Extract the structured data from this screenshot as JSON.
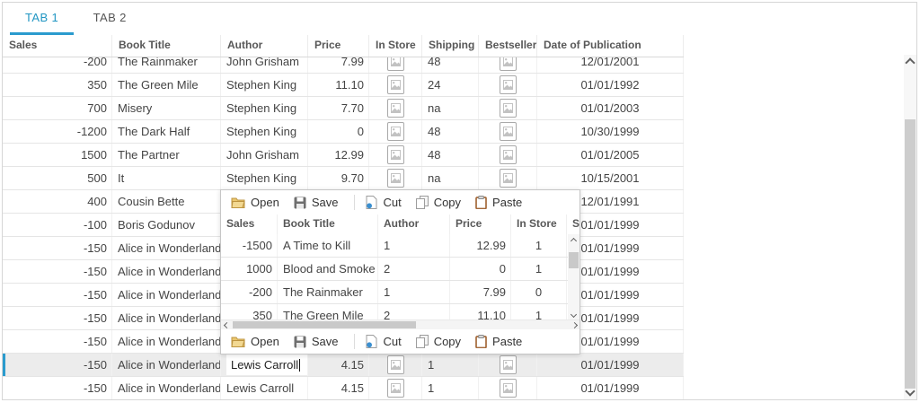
{
  "tabs": {
    "tab1": "TAB 1",
    "tab2": "TAB 2"
  },
  "colors": {
    "accent": "#2196c3",
    "selection_bar": "#2a9bce"
  },
  "toolbar": {
    "open": "Open",
    "save": "Save",
    "cut": "Cut",
    "copy": "Copy",
    "paste": "Paste"
  },
  "grid": {
    "columns": [
      "Sales",
      "Book Title",
      "Author",
      "Price",
      "In Store",
      "Shipping",
      "Bestseller",
      "Date of Publication"
    ],
    "rows": [
      {
        "sales": "-200",
        "title": "The Rainmaker",
        "author": "John Grisham",
        "price": "7.99",
        "shipping": "48",
        "date": "12/01/2001",
        "icons": true
      },
      {
        "sales": "350",
        "title": "The Green Mile",
        "author": "Stephen King",
        "price": "11.10",
        "shipping": "24",
        "date": "01/01/1992",
        "icons": true
      },
      {
        "sales": "700",
        "title": "Misery",
        "author": "Stephen King",
        "price": "7.70",
        "shipping": "na",
        "date": "01/01/2003",
        "icons": true
      },
      {
        "sales": "-1200",
        "title": "The Dark Half",
        "author": "Stephen King",
        "price": "0",
        "shipping": "48",
        "date": "10/30/1999",
        "icons": true
      },
      {
        "sales": "1500",
        "title": "The Partner",
        "author": "John Grisham",
        "price": "12.99",
        "shipping": "48",
        "date": "01/01/2005",
        "icons": true
      },
      {
        "sales": "500",
        "title": "It",
        "author": "Stephen King",
        "price": "9.70",
        "shipping": "na",
        "date": "10/15/2001",
        "icons": true
      },
      {
        "sales": "400",
        "title": "Cousin Bette",
        "author": "",
        "price": "",
        "shipping": "",
        "date": "12/01/1991",
        "icons": false
      },
      {
        "sales": "-100",
        "title": "Boris Godunov",
        "author": "",
        "price": "",
        "shipping": "",
        "date": "01/01/1999",
        "icons": false
      },
      {
        "sales": "-150",
        "title": "Alice in Wonderland",
        "author": "",
        "price": "",
        "shipping": "",
        "date": "01/01/1999",
        "icons": false
      },
      {
        "sales": "-150",
        "title": "Alice in Wonderland",
        "author": "",
        "price": "",
        "shipping": "",
        "date": "01/01/1999",
        "icons": false
      },
      {
        "sales": "-150",
        "title": "Alice in Wonderland",
        "author": "",
        "price": "",
        "shipping": "",
        "date": "01/01/1999",
        "icons": false
      },
      {
        "sales": "-150",
        "title": "Alice in Wonderland",
        "author": "",
        "price": "",
        "shipping": "",
        "date": "01/01/1999",
        "icons": false
      },
      {
        "sales": "-150",
        "title": "Alice in Wonderland",
        "author": "",
        "price": "",
        "shipping": "",
        "date": "01/01/1999",
        "icons": false
      },
      {
        "sales": "-150",
        "title": "Alice in Wonderland",
        "author": "Lewis Carroll",
        "price": "4.15",
        "shipping": "1",
        "date": "01/01/1999",
        "icons": true,
        "selected": true,
        "editing": true
      },
      {
        "sales": "-150",
        "title": "Alice in Wonderland",
        "author": "Lewis Carroll",
        "price": "4.15",
        "shipping": "1",
        "date": "01/01/1999",
        "icons": true
      }
    ]
  },
  "popup_grid": {
    "columns": [
      "Sales",
      "Book Title",
      "Author",
      "Price",
      "In Store",
      "Shipping"
    ],
    "rows": [
      {
        "sales": "-1500",
        "title": "A Time to Kill",
        "author": "1",
        "price": "12.99",
        "instore": "1"
      },
      {
        "sales": "1000",
        "title": "Blood and Smoke",
        "author": "2",
        "price": "0",
        "instore": "1"
      },
      {
        "sales": "-200",
        "title": "The Rainmaker",
        "author": "1",
        "price": "7.99",
        "instore": "0"
      },
      {
        "sales": "350",
        "title": "The Green Mile",
        "author": "2",
        "price": "11.10",
        "instore": "1"
      }
    ]
  },
  "editor": {
    "value": "Lewis Carroll"
  }
}
